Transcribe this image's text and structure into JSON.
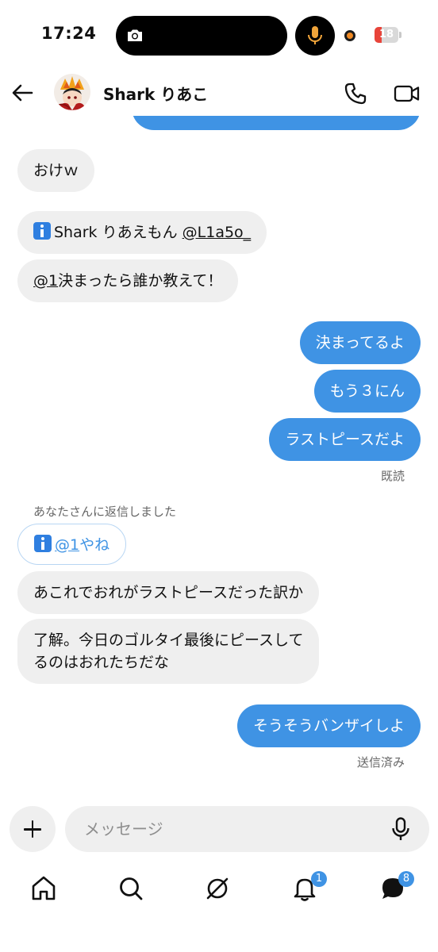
{
  "status_bar": {
    "time": "17:24",
    "battery_level": "18",
    "battery_color": "#e8443a",
    "recording_dot_color": "#f08a24",
    "mic_color": "#f0a43a"
  },
  "header": {
    "contact_name": "Shark りあこ",
    "back_icon": "arrow-left-icon",
    "call_icon": "phone-icon",
    "video_icon": "video-camera-icon"
  },
  "messages": [
    {
      "side": "in",
      "text": "おけｗ"
    },
    {
      "side": "in",
      "prefix": "Shark りあえもん ",
      "mention": "@L1a5o_"
    },
    {
      "side": "in",
      "mention": "@1",
      "text": "決まったら誰か教えて！"
    },
    {
      "side": "out",
      "text": "決まってるよ"
    },
    {
      "side": "out",
      "text": "もう３にん"
    },
    {
      "side": "out",
      "text": "ラストピースだよ"
    },
    {
      "side": "in",
      "mention": "@1",
      "suffix": "やね"
    },
    {
      "side": "in",
      "text": "あこれでおれがラストピースだった訳か"
    },
    {
      "side": "in",
      "line1": "了解。今日のゴルタイ最後にピースして",
      "line2": "るのはおれたちだな"
    },
    {
      "side": "out",
      "text": "そうそうバンザイしよ"
    }
  ],
  "status_read": "既読",
  "reply_note": "あなたさんに返信しました",
  "status_sent": "送信済み",
  "composer": {
    "placeholder": "メッセージ"
  },
  "nav": {
    "notifications_badge": "1",
    "messages_badge": "8",
    "accent_color": "#3f93e4"
  }
}
